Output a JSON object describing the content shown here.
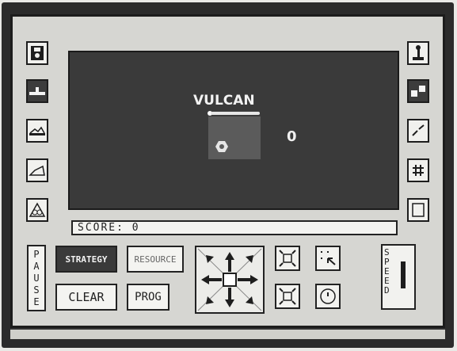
{
  "game": {
    "title": "VULCAN",
    "score_value": "0"
  },
  "status": {
    "score_label": "SCORE:",
    "score_value": "0"
  },
  "controls": {
    "pause_label": "PAUSE",
    "strategy_label": "STRATEGY",
    "resource_label": "RESOURCE",
    "clear_label": "CLEAR",
    "prog_label": "PROG",
    "speed_label": "SPEED"
  },
  "left_toolbar": [
    "floppy-disk-icon",
    "ship-icon",
    "landscape-icon",
    "draw-icon",
    "recycle-icon"
  ],
  "right_toolbar": [
    "joystick-icon",
    "dice-icon",
    "diagonal-icon",
    "grid-icon",
    "page-icon"
  ],
  "colors": {
    "screen": "#3a3a3a",
    "panel": "#d6d6d2",
    "frame": "#2b2b2b"
  }
}
